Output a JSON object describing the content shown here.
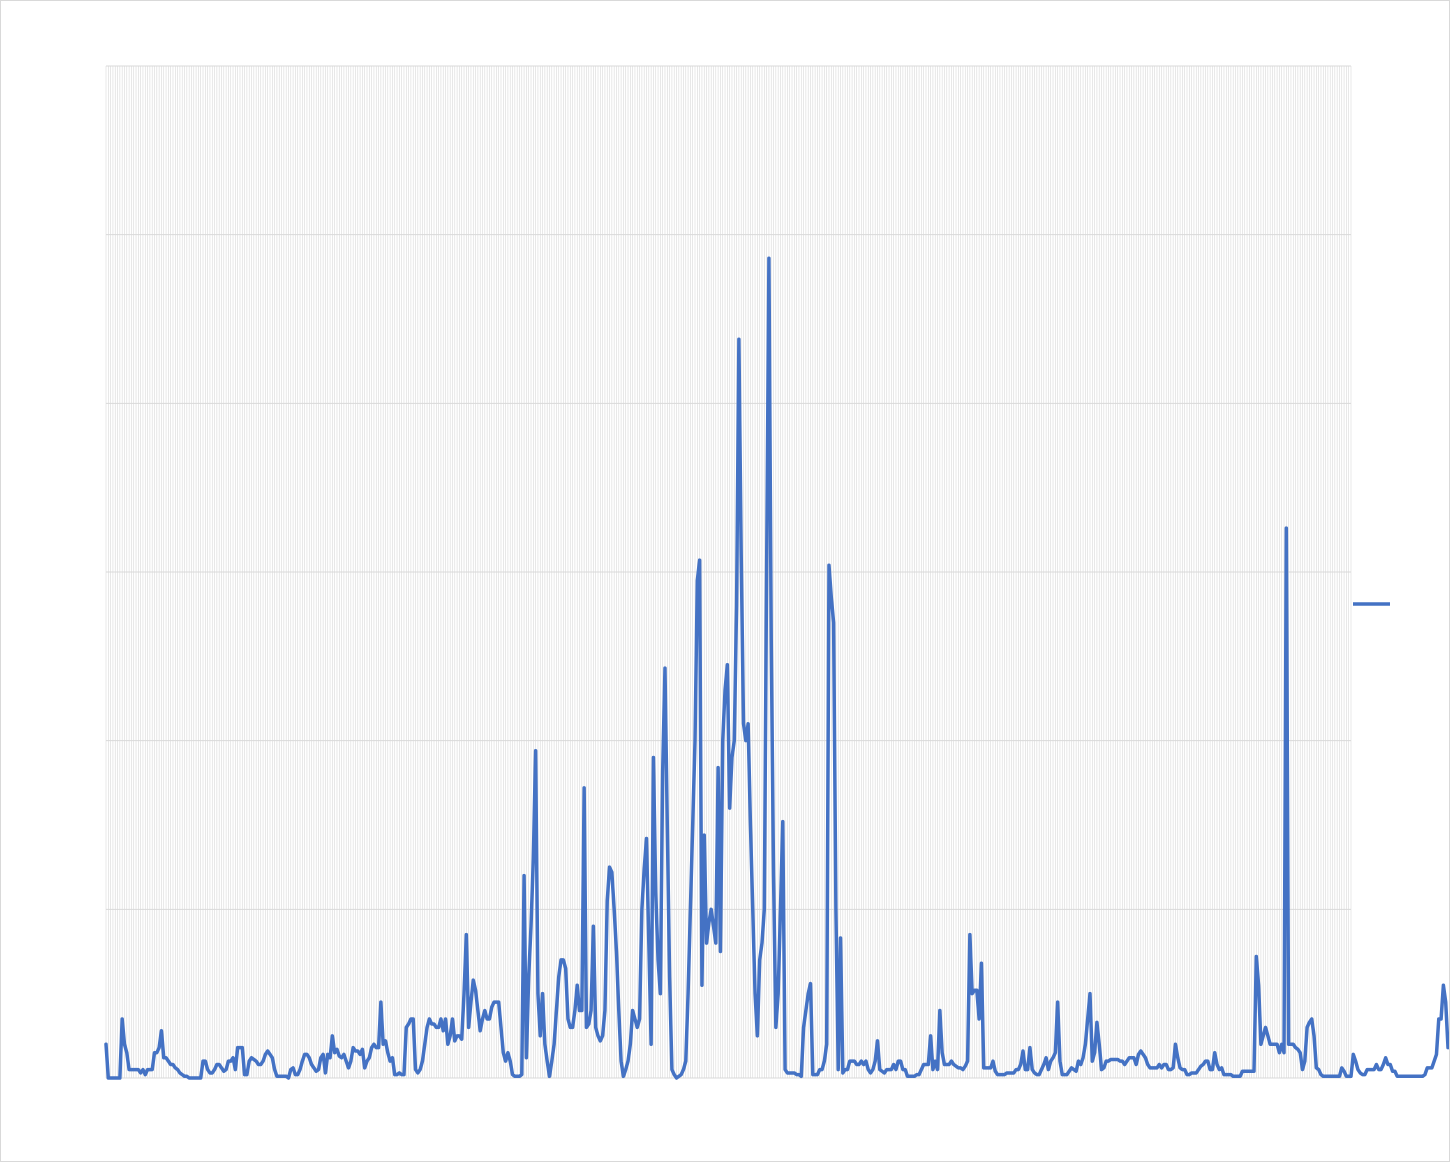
{
  "chart_data": {
    "type": "line",
    "title": "",
    "xlabel": "",
    "ylabel": "",
    "ylim": [
      0,
      6
    ],
    "y_gridlines": [
      0,
      1,
      2,
      3,
      4,
      5,
      6
    ],
    "x_count": 540,
    "x_gridlines": true,
    "y_grid": true,
    "legend": {
      "placement": "right",
      "entries": [
        ""
      ]
    },
    "colors": {
      "series": "#4472c4",
      "gridline": "#d9d9d9",
      "frame": "#d9d9d9"
    },
    "series": [
      {
        "values": [
          0.2,
          0,
          0,
          0,
          0,
          0,
          0,
          0.35,
          0.2,
          0.15,
          0.05,
          0.05,
          0.05,
          0.05,
          0.05,
          0.03,
          0.05,
          0.02,
          0.05,
          0.05,
          0.05,
          0.15,
          0.15,
          0.18,
          0.28,
          0.12,
          0.12,
          0.1,
          0.08,
          0.08,
          0.06,
          0.05,
          0.03,
          0.02,
          0.01,
          0.01,
          0,
          0,
          0,
          0,
          0,
          0,
          0.1,
          0.1,
          0.05,
          0.03,
          0.03,
          0.05,
          0.08,
          0.08,
          0.06,
          0.04,
          0.05,
          0.1,
          0.1,
          0.12,
          0.05,
          0.18,
          0.18,
          0.18,
          0.02,
          0.02,
          0.1,
          0.12,
          0.11,
          0.1,
          0.08,
          0.08,
          0.1,
          0.14,
          0.16,
          0.14,
          0.12,
          0.05,
          0.01,
          0.01,
          0.01,
          0.01,
          0.01,
          0,
          0.05,
          0.06,
          0.02,
          0.02,
          0.05,
          0.1,
          0.14,
          0.14,
          0.12,
          0.08,
          0.06,
          0.04,
          0.05,
          0.12,
          0.14,
          0.03,
          0.14,
          0.12,
          0.25,
          0.15,
          0.17,
          0.13,
          0.12,
          0.14,
          0.1,
          0.06,
          0.1,
          0.18,
          0.16,
          0.16,
          0.14,
          0.17,
          0.06,
          0.1,
          0.12,
          0.18,
          0.2,
          0.18,
          0.18,
          0.45,
          0.2,
          0.22,
          0.15,
          0.1,
          0.12,
          0.02,
          0.02,
          0.03,
          0.02,
          0.02,
          0.3,
          0.32,
          0.35,
          0.35,
          0.05,
          0.03,
          0.05,
          0.1,
          0.2,
          0.3,
          0.35,
          0.32,
          0.32,
          0.3,
          0.3,
          0.35,
          0.28,
          0.35,
          0.2,
          0.25,
          0.35,
          0.22,
          0.25,
          0.25,
          0.23,
          0.5,
          0.85,
          0.3,
          0.45,
          0.58,
          0.52,
          0.4,
          0.28,
          0.35,
          0.4,
          0.35,
          0.35,
          0.42,
          0.45,
          0.45,
          0.45,
          0.3,
          0.15,
          0.1,
          0.15,
          0.1,
          0.02,
          0.01,
          0.01,
          0.01,
          0.02,
          1.2,
          0.12,
          0.6,
          0.9,
          1.3,
          1.94,
          0.5,
          0.25,
          0.5,
          0.2,
          0.1,
          0.01,
          0.1,
          0.2,
          0.4,
          0.6,
          0.7,
          0.7,
          0.65,
          0.35,
          0.3,
          0.3,
          0.4,
          0.55,
          0.4,
          0.4,
          1.72,
          0.3,
          0.32,
          0.4,
          0.9,
          0.3,
          0.25,
          0.22,
          0.25,
          0.4,
          1.05,
          1.25,
          1.22,
          1.0,
          0.75,
          0.4,
          0.1,
          0.01,
          0.05,
          0.1,
          0.2,
          0.4,
          0.35,
          0.3,
          0.35,
          1.0,
          1.24,
          1.42,
          0.8,
          0.2,
          1.9,
          1.1,
          0.7,
          0.5,
          1.82,
          2.43,
          1.5,
          0.6,
          0.05,
          0.02,
          0.0,
          0.01,
          0.02,
          0.05,
          0.1,
          0.5,
          1.0,
          1.5,
          2.0,
          2.95,
          3.07,
          0.55,
          1.44,
          0.8,
          0.92,
          1.0,
          0.9,
          0.8,
          1.84,
          0.75,
          2.0,
          2.3,
          2.45,
          1.6,
          1.9,
          2.0,
          2.8,
          4.38,
          3.1,
          2.1,
          2.0,
          2.1,
          1.5,
          1.0,
          0.5,
          0.25,
          0.7,
          0.8,
          1.0,
          3.0,
          4.86,
          2.6,
          1.2,
          0.3,
          0.5,
          1.0,
          1.52,
          0.05,
          0.03,
          0.03,
          0.03,
          0.03,
          0.02,
          0.02,
          0.01,
          0.3,
          0.4,
          0.5,
          0.56,
          0.02,
          0.02,
          0.02,
          0.05,
          0.05,
          0.1,
          0.2,
          3.04,
          2.85,
          2.7,
          1.0,
          0.05,
          0.83,
          0.03,
          0.05,
          0.05,
          0.1,
          0.1,
          0.1,
          0.08,
          0.08,
          0.1,
          0.08,
          0.1,
          0.05,
          0.03,
          0.05,
          0.1,
          0.22,
          0.05,
          0.04,
          0.03,
          0.05,
          0.05,
          0.05,
          0.08,
          0.05,
          0.1,
          0.1,
          0.05,
          0.05,
          0.01,
          0.01,
          0.01,
          0.01,
          0.02,
          0.02,
          0.05,
          0.08,
          0.08,
          0.08,
          0.25,
          0.05,
          0.1,
          0.05,
          0.4,
          0.15,
          0.08,
          0.08,
          0.08,
          0.1,
          0.08,
          0.07,
          0.06,
          0.06,
          0.05,
          0.07,
          0.1,
          0.85,
          0.5,
          0.52,
          0.52,
          0.35,
          0.68,
          0.06,
          0.06,
          0.06,
          0.06,
          0.1,
          0.04,
          0.02,
          0.02,
          0.02,
          0.02,
          0.03,
          0.03,
          0.03,
          0.03,
          0.05,
          0.05,
          0.08,
          0.16,
          0.05,
          0.05,
          0.18,
          0.05,
          0.03,
          0.02,
          0.02,
          0.05,
          0.08,
          0.12,
          0.05,
          0.1,
          0.12,
          0.15,
          0.45,
          0.1,
          0.02,
          0.02,
          0.02,
          0.04,
          0.06,
          0.05,
          0.04,
          0.1,
          0.08,
          0.12,
          0.2,
          0.35,
          0.5,
          0.1,
          0.15,
          0.33,
          0.2,
          0.05,
          0.06,
          0.1,
          0.1,
          0.11,
          0.11,
          0.11,
          0.11,
          0.1,
          0.1,
          0.08,
          0.1,
          0.12,
          0.12,
          0.12,
          0.08,
          0.14,
          0.16,
          0.14,
          0.12,
          0.08,
          0.06,
          0.06,
          0.06,
          0.06,
          0.08,
          0.06,
          0.08,
          0.08,
          0.05,
          0.05,
          0.06,
          0.2,
          0.12,
          0.06,
          0.05,
          0.05,
          0.02,
          0.02,
          0.03,
          0.03,
          0.03,
          0.05,
          0.07,
          0.08,
          0.1,
          0.1,
          0.05,
          0.05,
          0.15,
          0.08,
          0.05,
          0.06,
          0.02,
          0.02,
          0.02,
          0.02,
          0.01,
          0.01,
          0.01,
          0.01,
          0.04,
          0.04,
          0.04,
          0.04,
          0.04,
          0.04,
          0.72,
          0.55,
          0.2,
          0.25,
          0.3,
          0.25,
          0.2,
          0.2,
          0.2,
          0.2,
          0.15,
          0.2,
          0.15,
          3.26,
          0.2,
          0.2,
          0.2,
          0.18,
          0.17,
          0.15,
          0.05,
          0.1,
          0.3,
          0.33,
          0.35,
          0.25,
          0.06,
          0.05,
          0.02,
          0.01,
          0.01,
          0.01,
          0.01,
          0.01,
          0.01,
          0.01,
          0.01,
          0.06,
          0.04,
          0.01,
          0.01,
          0.01,
          0.14,
          0.1,
          0.05,
          0.03,
          0.02,
          0.02,
          0.05,
          0.05,
          0.05,
          0.05,
          0.08,
          0.05,
          0.05,
          0.08,
          0.12,
          0.08,
          0.08,
          0.04,
          0.04,
          0.01,
          0.01,
          0.01,
          0.01,
          0.01,
          0.01,
          0.01,
          0.01,
          0.01,
          0.01,
          0.01,
          0.01,
          0.02,
          0.06,
          0.06,
          0.06,
          0.1,
          0.14,
          0.35,
          0.35,
          0.55,
          0.45,
          0.18,
          0.2,
          0.2,
          0.25,
          0.3,
          0.45,
          0.65,
          0.55,
          0.45
        ]
      }
    ]
  }
}
